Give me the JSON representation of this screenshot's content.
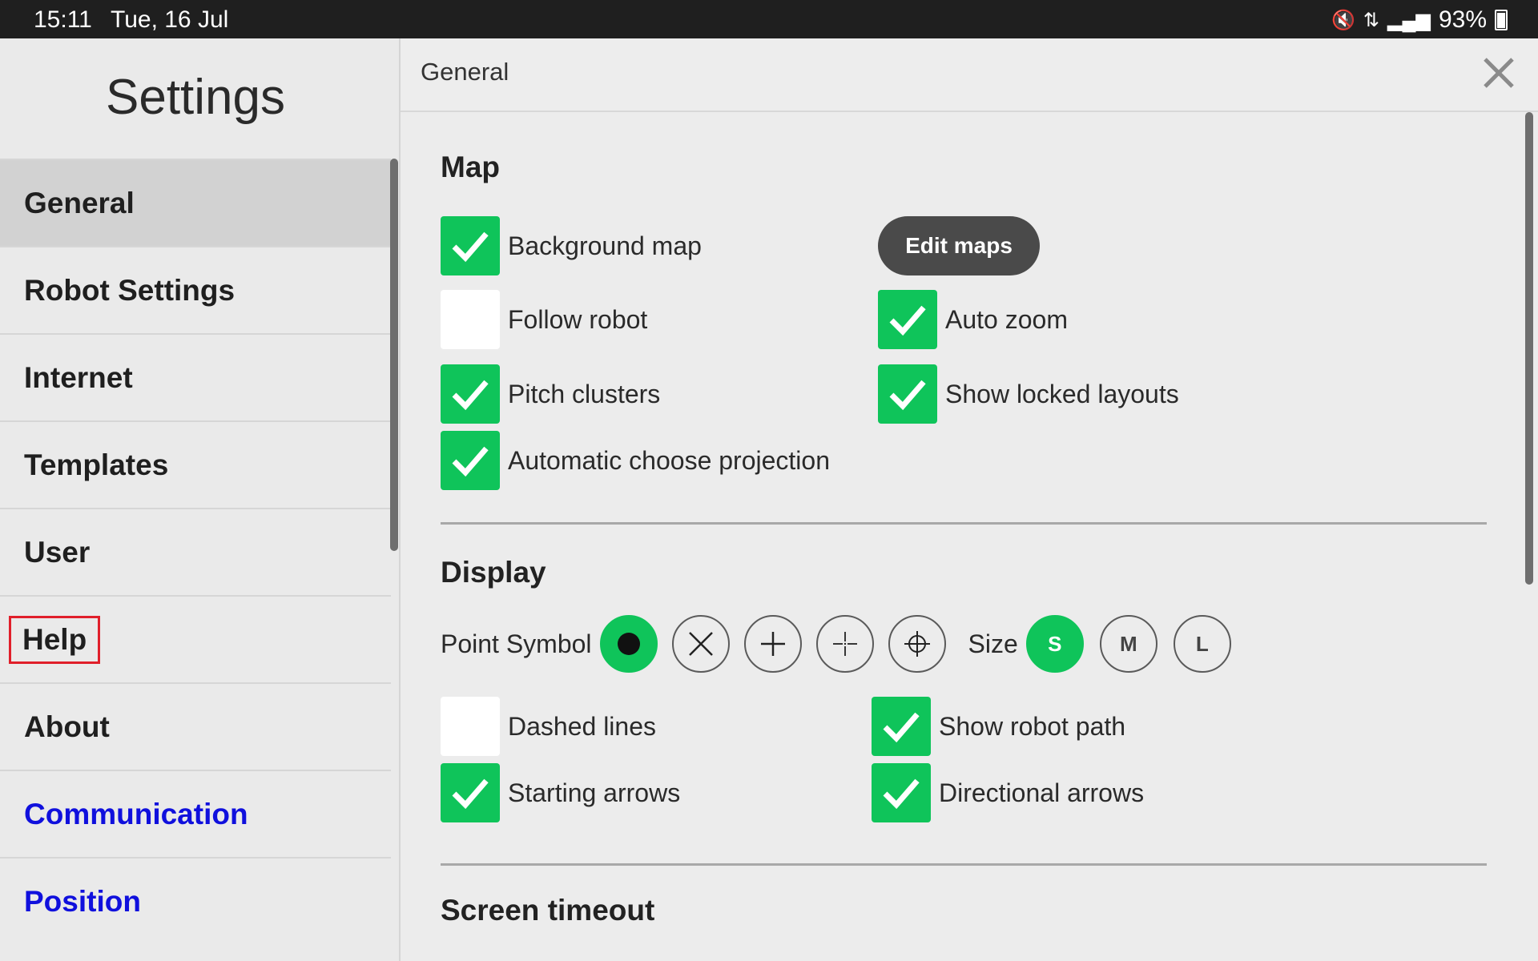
{
  "status_bar": {
    "time": "15:11",
    "date": "Tue, 16 Jul",
    "battery": "93%"
  },
  "sidebar": {
    "title": "Settings",
    "items": [
      {
        "label": "General"
      },
      {
        "label": "Robot Settings"
      },
      {
        "label": "Internet"
      },
      {
        "label": "Templates"
      },
      {
        "label": "User"
      },
      {
        "label": "Help"
      },
      {
        "label": "About"
      },
      {
        "label": "Communication"
      },
      {
        "label": "Position"
      }
    ]
  },
  "main": {
    "header_title": "General",
    "map": {
      "title": "Map",
      "background_map": {
        "label": "Background map",
        "checked": true
      },
      "edit_maps_label": "Edit maps",
      "follow_robot": {
        "label": "Follow robot",
        "checked": false
      },
      "auto_zoom": {
        "label": "Auto zoom",
        "checked": true
      },
      "pitch_clusters": {
        "label": "Pitch clusters",
        "checked": true
      },
      "show_locked_layouts": {
        "label": "Show locked layouts",
        "checked": true
      },
      "auto_projection": {
        "label": "Automatic choose projection",
        "checked": true
      }
    },
    "display": {
      "title": "Display",
      "point_symbol_label": "Point Symbol",
      "point_symbols": [
        "filled-dot-icon",
        "x-circle-icon",
        "plus-icon",
        "thin-cross-icon",
        "crosshair-icon"
      ],
      "selected_symbol": "filled-dot-icon",
      "size_label": "Size",
      "sizes": [
        "S",
        "M",
        "L"
      ],
      "selected_size": "S",
      "dashed_lines": {
        "label": "Dashed lines",
        "checked": false
      },
      "show_robot_path": {
        "label": "Show robot path",
        "checked": true
      },
      "starting_arrows": {
        "label": "Starting arrows",
        "checked": true
      },
      "directional_arrows": {
        "label": "Directional arrows",
        "checked": true
      }
    },
    "screen_timeout": {
      "title": "Screen timeout"
    }
  },
  "colors": {
    "accent_green": "#0fc45a",
    "link_blue": "#1010dd",
    "highlight_red": "#e01f2a"
  }
}
